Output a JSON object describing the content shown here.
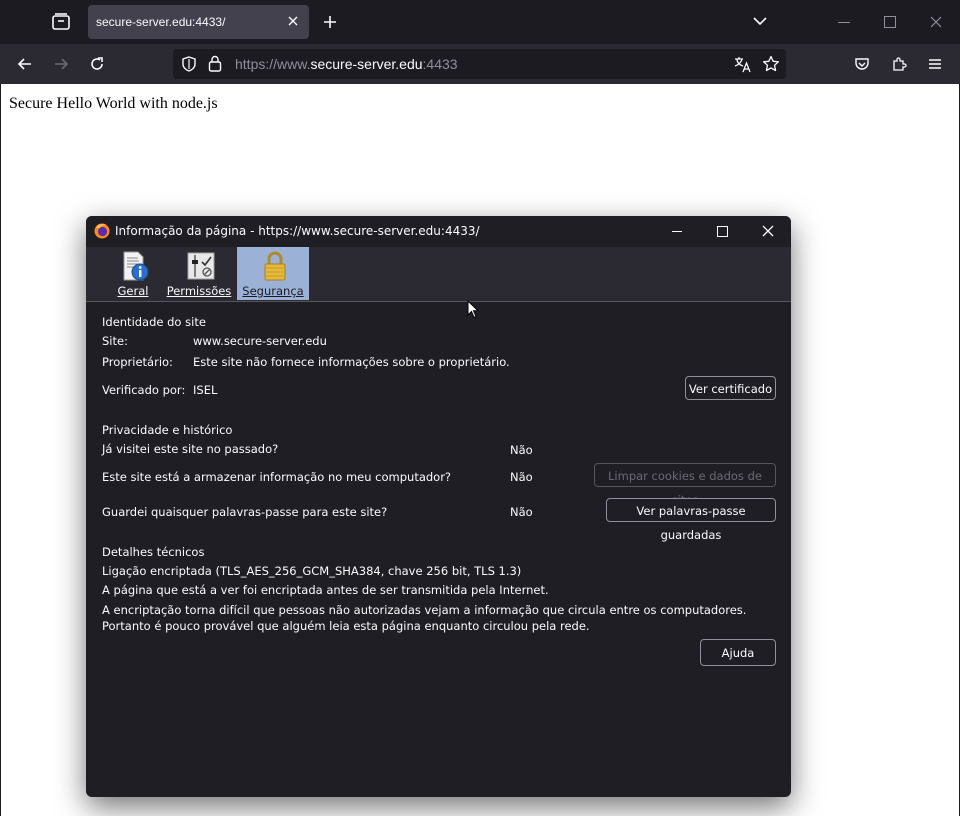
{
  "browser": {
    "tab_title": "secure-server.edu:4433/",
    "url_prefix": "https://www.",
    "url_host": "secure-server.edu",
    "url_suffix": ":4433"
  },
  "page": {
    "body_text": "Secure Hello World with node.js"
  },
  "dialog": {
    "title": "Informação da página - https://www.secure-server.edu:4433/",
    "tabs": [
      {
        "label": "Geral",
        "icon": "info-document-icon"
      },
      {
        "label": "Permissões",
        "icon": "permissions-sliders-icon"
      },
      {
        "label": "Segurança",
        "icon": "padlock-icon",
        "selected": true
      }
    ],
    "identity": {
      "heading": "Identidade do site",
      "site_label": "Site:",
      "site_value": "www.secure-server.edu",
      "owner_label": "Proprietário:",
      "owner_value": "Este site não fornece informações sobre o proprietário.",
      "verified_label": "Verificado por:",
      "verified_value": "ISEL",
      "view_cert_button": "Ver certificado"
    },
    "privacy": {
      "heading": "Privacidade e histórico",
      "visited_q": "Já visitei este site no passado?",
      "visited_a": "Não",
      "storing_q": "Este site está a armazenar informação no meu computador?",
      "storing_a": "Não",
      "clear_button": "Limpar cookies e dados de sites",
      "passwords_q": "Guardei quaisquer palavras-passe para este site?",
      "passwords_a": "Não",
      "view_passwords_button": "Ver palavras-passe guardadas"
    },
    "technical": {
      "heading": "Detalhes técnicos",
      "line1": "Ligação encriptada (TLS_AES_256_GCM_SHA384, chave 256 bit, TLS 1.3)",
      "line2": "A página que está a ver foi encriptada antes de ser transmitida pela Internet.",
      "line3": "A encriptação torna difícil que pessoas não autorizadas vejam a informação que circula entre os computadores. Portanto é pouco provável que alguém leia esta página enquanto circulou pela rede."
    },
    "help_button": "Ajuda"
  },
  "colors": {
    "accent_selected_tab": "#9bb2d6",
    "dialog_bg": "#1f1e25",
    "chrome_bg": "#1c1b22"
  }
}
